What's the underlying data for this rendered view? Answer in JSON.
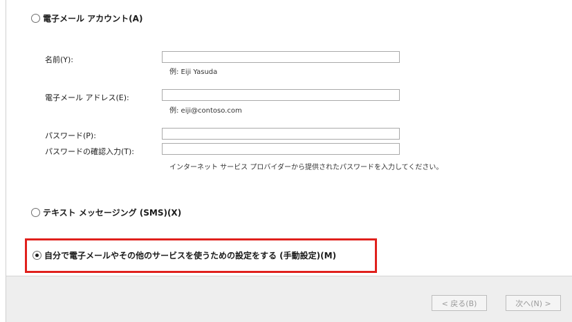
{
  "options": {
    "email_account": {
      "label": "電子メール アカウント(A)",
      "selected": false
    },
    "sms": {
      "label": "テキスト メッセージング (SMS)(X)",
      "selected": false
    },
    "manual": {
      "label": "自分で電子メールやその他のサービスを使うための設定をする (手動設定)(M)",
      "selected": true
    }
  },
  "form": {
    "name": {
      "label": "名前(Y):",
      "value": "",
      "hint": "例: Eiji Yasuda"
    },
    "email": {
      "label": "電子メール アドレス(E):",
      "value": "",
      "hint": "例: eiji@contoso.com"
    },
    "password": {
      "label": "パスワード(P):",
      "value": ""
    },
    "password_confirm": {
      "label": "パスワードの確認入力(T):",
      "value": ""
    },
    "password_hint": "インターネット サービス プロバイダーから提供されたパスワードを入力してください。"
  },
  "buttons": {
    "back": "< 戻る(B)",
    "next": "次へ(N) >"
  },
  "colors": {
    "highlight_border": "#e0201c",
    "footer_bg": "#eeeeee"
  }
}
